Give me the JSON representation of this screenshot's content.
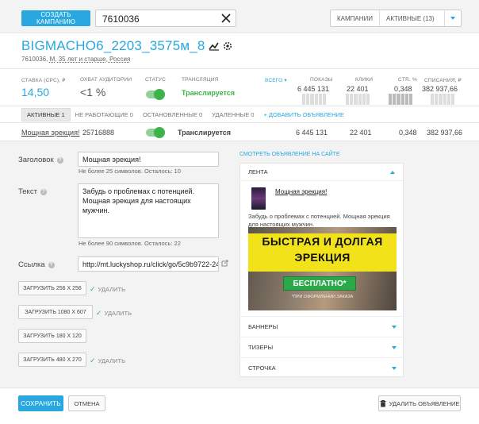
{
  "topbar": {
    "create_label": "Создать кампанию",
    "search_value": "7610036",
    "campaigns_label": "Кампании",
    "active_filter": "Активные (13)"
  },
  "campaign": {
    "title": "BIGMACHO6_2203_3575м_8",
    "id": "7610036,",
    "targeting": "М, 35 лет и старше, Россия"
  },
  "stats": {
    "rate_label": "Ставка (CPC), ₽",
    "rate_value": "14,50",
    "reach_label": "Охват аудитории",
    "reach_value": "<1 %",
    "status_label": "Статус",
    "broadcast_label": "Трансляция",
    "broadcast_value": "Транслируется",
    "total_label": "Всего",
    "shows_label": "Показы",
    "shows_value": "6 445 131",
    "clicks_label": "Клики",
    "clicks_value": "22 401",
    "ctr_label": "CTR, %",
    "ctr_value": "0,348",
    "spend_label": "Списания, ₽",
    "spend_value": "382 937,66"
  },
  "tabs": [
    {
      "label": "Активные 1"
    },
    {
      "label": "Не работающие 0"
    },
    {
      "label": "Остановленные 0"
    },
    {
      "label": "Удаленные 0"
    },
    {
      "label": "+ Добавить объявление"
    }
  ],
  "ad_row": {
    "name": "Мощная эрекция!",
    "id": "25716888",
    "status": "Транслируется",
    "shows": "6 445 131",
    "clicks": "22 401",
    "ctr": "0,348",
    "spend": "382 937,66"
  },
  "editor": {
    "headline_label": "Заголовок",
    "headline_value": "Мощная эрекция!",
    "headline_hint": "Не более 25 символов. Осталось: 10",
    "text_label": "Текст",
    "text_value": "Забудь о проблемах с потенцией.\nМощная эрекция для настоящих мужчин.",
    "text_hint": "Не более 90 символов. Осталось: 22",
    "link_label": "Ссылка",
    "link_value": "http://mt.luckyshop.ru/click/go/5c9b9722-24",
    "upload_256": "Загрузить 256 x 256",
    "upload_1080": "Загрузить 1080 x 607",
    "upload_180": "Загрузить 180 x 120",
    "upload_480": "Загрузить 480 x 270",
    "delete_label": "Удалить"
  },
  "preview": {
    "view_link": "Смотреть объявление на сайте",
    "feed_label": "Лента",
    "ad_title": "Мощная эрекция!",
    "ad_text": "Забудь о проблемах с потенцией. Мощная эрекция для настоящих мужчин.",
    "banner_line1": "БЫСТРАЯ И ДОЛГАЯ",
    "banner_line2": "ЭРЕКЦИЯ",
    "banner_button": "БЕСПЛАТНО*",
    "banner_note": "*при оформлении заказа",
    "banners_label": "Баннеры",
    "teasers_label": "Тизеры",
    "line_label": "Строчка"
  },
  "footer": {
    "save_label": "Сохранить",
    "cancel_label": "Отмена",
    "delete_ad_label": "Удалить объявление"
  },
  "colors": {
    "accent": "#29a8e0",
    "success": "#3db34a",
    "banner_yellow": "#f2e21a"
  }
}
